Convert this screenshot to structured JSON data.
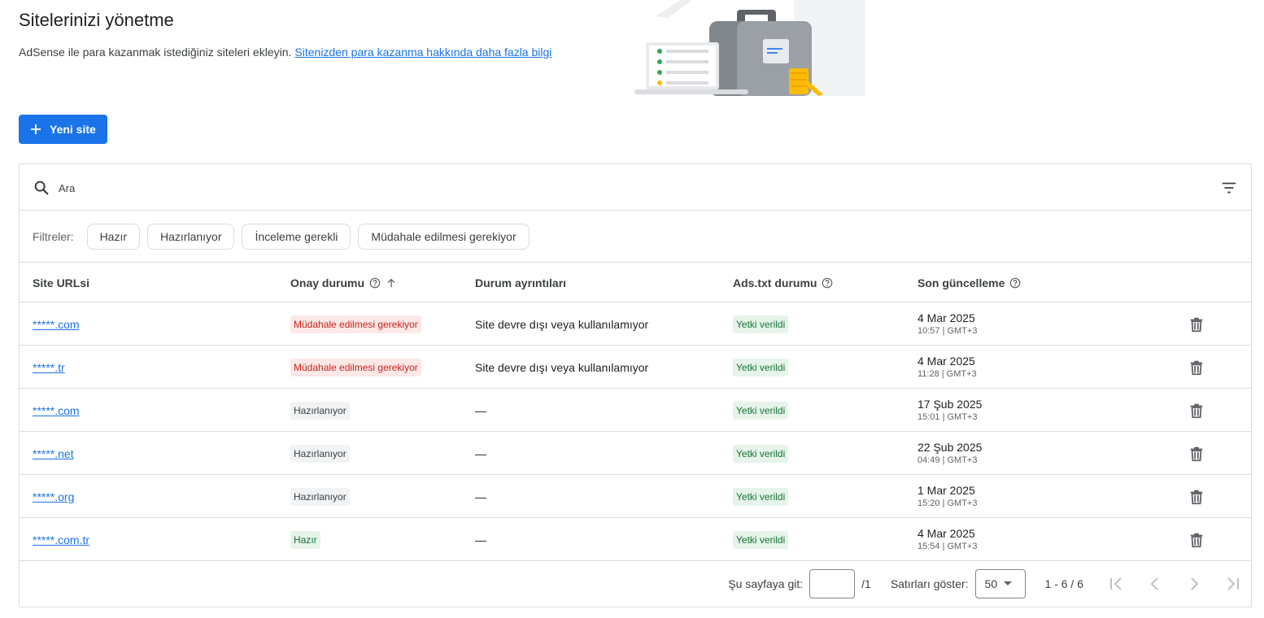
{
  "header": {
    "title": "Sitelerinizi yönetme",
    "description": "AdSense ile para kazanmak istediğiniz siteleri ekleyin.",
    "link_text": "Sitenizden para kazanma hakkında daha fazla bilgi"
  },
  "new_site_button": {
    "label": "Yeni site",
    "icon": "plus-icon"
  },
  "search": {
    "placeholder": "Ara",
    "value": "",
    "icon": "search-icon",
    "filter_icon": "filter-list-icon"
  },
  "filters": {
    "label": "Filtreler:",
    "chips": [
      "Hazır",
      "Hazırlanıyor",
      "İnceleme gerekli",
      "Müdahale edilmesi gerekiyor"
    ]
  },
  "table": {
    "columns": [
      "Site URLsi",
      "Onay durumu",
      "Durum ayrıntıları",
      "Ads.txt durumu",
      "Son güncelleme"
    ],
    "rows": [
      {
        "url": "*****.com",
        "status": "Müdahale edilmesi gerekiyor",
        "status_kind": "red",
        "details": "Site devre dışı veya kullanılamıyor",
        "ads": "Yetki verildi",
        "date": "4 Mar 2025",
        "time": "10:57 | GMT+3"
      },
      {
        "url": "*****.tr",
        "status": "Müdahale edilmesi gerekiyor",
        "status_kind": "red",
        "details": "Site devre dışı veya kullanılamıyor",
        "ads": "Yetki verildi",
        "date": "4 Mar 2025",
        "time": "11:28 | GMT+3"
      },
      {
        "url": "*****.com",
        "status": "Hazırlanıyor",
        "status_kind": "gray",
        "details": "—",
        "ads": "Yetki verildi",
        "date": "17 Şub 2025",
        "time": "15:01 | GMT+3"
      },
      {
        "url": "*****.net",
        "status": "Hazırlanıyor",
        "status_kind": "gray",
        "details": "—",
        "ads": "Yetki verildi",
        "date": "22 Şub 2025",
        "time": "04:49 | GMT+3"
      },
      {
        "url": "*****.org",
        "status": "Hazırlanıyor",
        "status_kind": "gray",
        "details": "—",
        "ads": "Yetki verildi",
        "date": "1 Mar 2025",
        "time": "15:20 | GMT+3"
      },
      {
        "url": "*****.com.tr",
        "status": "Hazır",
        "status_kind": "green",
        "details": "—",
        "ads": "Yetki verildi",
        "date": "4 Mar 2025",
        "time": "15:54 | GMT+3"
      }
    ]
  },
  "pagination": {
    "goto_label": "Şu sayfaya git:",
    "goto_value": "",
    "total_pages": "/1",
    "rows_label": "Satırları göster:",
    "rows_value": "50",
    "range": "1 - 6 / 6"
  },
  "colors": {
    "primary": "#1a73e8",
    "badge_red_bg": "#fce8e6",
    "badge_red_text": "#c5221f",
    "badge_green_bg": "#e6f4ea",
    "badge_green_text": "#137333",
    "badge_gray_bg": "#f1f3f4"
  }
}
